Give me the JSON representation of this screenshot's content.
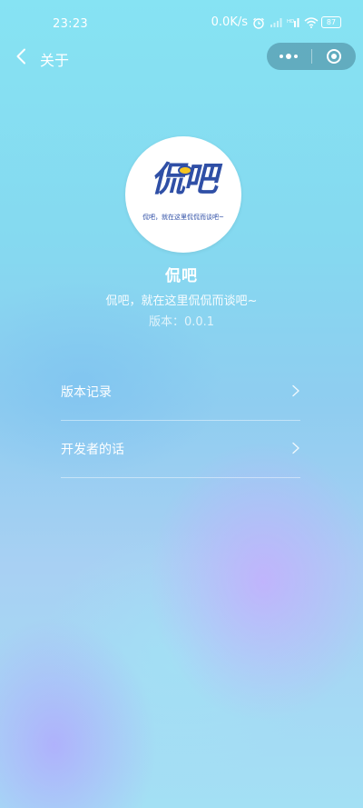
{
  "status_bar": {
    "time": "23:23",
    "net_speed": "0.0K/s",
    "alarm_icon": "alarm-clock-icon",
    "signal_icon": "cellular-signal-icon",
    "hd_icon": "hd-icon",
    "wifi_icon": "wifi-icon",
    "battery_level": "87"
  },
  "nav": {
    "back_icon": "chevron-left-icon",
    "title": "关于",
    "more_icon": "more-dots-icon",
    "close_icon": "target-close-icon"
  },
  "logo": {
    "text": "侃吧",
    "tagline": "侃吧，就在这里侃侃而谈吧~"
  },
  "app": {
    "name": "侃吧",
    "slogan": "侃吧，就在这里侃侃而谈吧~",
    "version": "版本：0.0.1"
  },
  "menu": {
    "items": [
      {
        "label": "版本记录",
        "arrow_icon": "chevron-right-icon"
      },
      {
        "label": "开发者的话",
        "arrow_icon": "chevron-right-icon"
      }
    ]
  },
  "colors": {
    "background_top": "#86e3f3",
    "background_bottom": "#a3e0f4",
    "logo_blue": "#2f4fa6",
    "logo_yellow": "#f6c520",
    "text": "#ffffff"
  }
}
